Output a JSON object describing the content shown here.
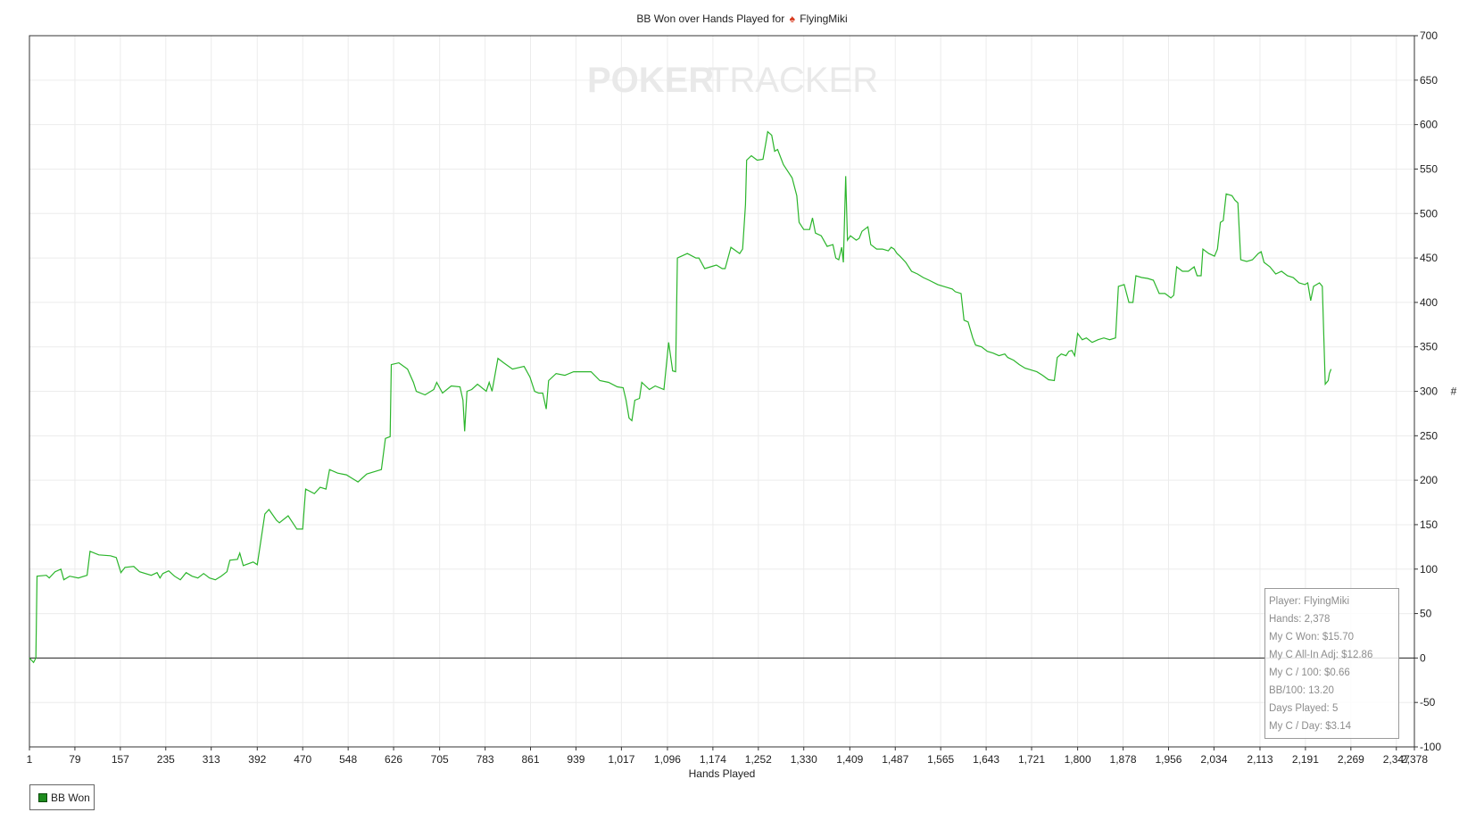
{
  "title_prefix": "BB Won over Hands Played for",
  "player_name": "FlyingMiki",
  "watermark": {
    "left": "POKER",
    "right": "TRACKER"
  },
  "legend": {
    "label": "BB Won",
    "swatch_color": "#1e8c1e",
    "icon": "green-square-icon"
  },
  "title_icon": "spade-icon",
  "stats": [
    "Player: FlyingMiki",
    "Hands: 2,378",
    "My C Won: $15.70",
    "My C All-In Adj: $12.86",
    "My C / 100: $0.66",
    "BB/100: 13.20",
    "Days Played: 5",
    "My C / Day: $3.14"
  ],
  "chart_data": {
    "type": "line",
    "title": "BB Won over Hands Played for FlyingMiki",
    "xlabel": "Hands Played",
    "ylabel": "#",
    "xlim": [
      1,
      2378
    ],
    "ylim": [
      -100,
      700
    ],
    "x_ticks": [
      "1",
      "79",
      "157",
      "235",
      "313",
      "392",
      "470",
      "548",
      "626",
      "705",
      "783",
      "861",
      "939",
      "1,017",
      "1,096",
      "1,174",
      "1,252",
      "1,330",
      "1,409",
      "1,487",
      "1,565",
      "1,643",
      "1,721",
      "1,800",
      "1,878",
      "1,956",
      "2,034",
      "2,113",
      "2,191",
      "2,269",
      "2,347",
      "2,378"
    ],
    "y_ticks": [
      700,
      650,
      600,
      550,
      500,
      450,
      400,
      350,
      300,
      250,
      200,
      150,
      100,
      50,
      0,
      -50,
      -100
    ],
    "grid": true,
    "legend_position": "bottom-left",
    "series": [
      {
        "name": "BB Won",
        "color": "#2bb52b",
        "points": [
          [
            1,
            0
          ],
          [
            8,
            -5
          ],
          [
            12,
            0
          ],
          [
            14,
            92
          ],
          [
            30,
            93
          ],
          [
            35,
            90
          ],
          [
            45,
            97
          ],
          [
            55,
            100
          ],
          [
            60,
            88
          ],
          [
            70,
            92
          ],
          [
            85,
            90
          ],
          [
            100,
            93
          ],
          [
            105,
            120
          ],
          [
            120,
            116
          ],
          [
            140,
            115
          ],
          [
            150,
            113
          ],
          [
            158,
            96
          ],
          [
            165,
            102
          ],
          [
            180,
            103
          ],
          [
            190,
            97
          ],
          [
            210,
            93
          ],
          [
            220,
            96
          ],
          [
            225,
            90
          ],
          [
            230,
            95
          ],
          [
            240,
            98
          ],
          [
            250,
            92
          ],
          [
            260,
            88
          ],
          [
            270,
            96
          ],
          [
            280,
            92
          ],
          [
            290,
            90
          ],
          [
            300,
            95
          ],
          [
            310,
            90
          ],
          [
            320,
            88
          ],
          [
            330,
            92
          ],
          [
            340,
            97
          ],
          [
            345,
            110
          ],
          [
            358,
            111
          ],
          [
            362,
            118
          ],
          [
            368,
            104
          ],
          [
            385,
            108
          ],
          [
            392,
            105
          ],
          [
            405,
            162
          ],
          [
            412,
            167
          ],
          [
            425,
            155
          ],
          [
            430,
            152
          ],
          [
            445,
            160
          ],
          [
            455,
            150
          ],
          [
            460,
            145
          ],
          [
            470,
            145
          ],
          [
            475,
            190
          ],
          [
            490,
            185
          ],
          [
            500,
            192
          ],
          [
            510,
            190
          ],
          [
            516,
            212
          ],
          [
            530,
            208
          ],
          [
            545,
            206
          ],
          [
            555,
            202
          ],
          [
            560,
            200
          ],
          [
            565,
            198
          ],
          [
            580,
            207
          ],
          [
            595,
            210
          ],
          [
            605,
            212
          ],
          [
            612,
            247
          ],
          [
            620,
            249
          ],
          [
            622,
            330
          ],
          [
            635,
            332
          ],
          [
            650,
            325
          ],
          [
            660,
            310
          ],
          [
            665,
            300
          ],
          [
            680,
            296
          ],
          [
            695,
            302
          ],
          [
            700,
            310
          ],
          [
            710,
            298
          ],
          [
            725,
            306
          ],
          [
            740,
            305
          ],
          [
            745,
            290
          ],
          [
            748,
            255
          ],
          [
            752,
            300
          ],
          [
            760,
            302
          ],
          [
            770,
            308
          ],
          [
            785,
            300
          ],
          [
            790,
            310
          ],
          [
            795,
            300
          ],
          [
            805,
            337
          ],
          [
            815,
            332
          ],
          [
            830,
            325
          ],
          [
            850,
            328
          ],
          [
            860,
            316
          ],
          [
            868,
            300
          ],
          [
            875,
            298
          ],
          [
            882,
            298
          ],
          [
            888,
            280
          ],
          [
            892,
            312
          ],
          [
            905,
            320
          ],
          [
            920,
            318
          ],
          [
            935,
            322
          ],
          [
            950,
            322
          ],
          [
            965,
            322
          ],
          [
            980,
            312
          ],
          [
            995,
            310
          ],
          [
            1010,
            305
          ],
          [
            1020,
            304
          ],
          [
            1025,
            290
          ],
          [
            1030,
            270
          ],
          [
            1035,
            267
          ],
          [
            1040,
            290
          ],
          [
            1048,
            292
          ],
          [
            1052,
            310
          ],
          [
            1065,
            302
          ],
          [
            1075,
            306
          ],
          [
            1090,
            302
          ],
          [
            1098,
            355
          ],
          [
            1105,
            323
          ],
          [
            1110,
            322
          ],
          [
            1113,
            450
          ],
          [
            1130,
            455
          ],
          [
            1145,
            450
          ],
          [
            1150,
            450
          ],
          [
            1160,
            438
          ],
          [
            1170,
            440
          ],
          [
            1180,
            442
          ],
          [
            1190,
            438
          ],
          [
            1195,
            438
          ],
          [
            1205,
            462
          ],
          [
            1220,
            455
          ],
          [
            1225,
            460
          ],
          [
            1230,
            510
          ],
          [
            1232,
            560
          ],
          [
            1240,
            565
          ],
          [
            1250,
            560
          ],
          [
            1260,
            561
          ],
          [
            1265,
            580
          ],
          [
            1268,
            592
          ],
          [
            1275,
            588
          ],
          [
            1280,
            570
          ],
          [
            1285,
            572
          ],
          [
            1295,
            555
          ],
          [
            1302,
            548
          ],
          [
            1310,
            540
          ],
          [
            1318,
            520
          ],
          [
            1322,
            490
          ],
          [
            1330,
            482
          ],
          [
            1340,
            482
          ],
          [
            1345,
            495
          ],
          [
            1350,
            478
          ],
          [
            1360,
            475
          ],
          [
            1370,
            463
          ],
          [
            1380,
            465
          ],
          [
            1385,
            450
          ],
          [
            1390,
            448
          ],
          [
            1395,
            462
          ],
          [
            1398,
            445
          ],
          [
            1402,
            542
          ],
          [
            1405,
            470
          ],
          [
            1410,
            475
          ],
          [
            1420,
            470
          ],
          [
            1425,
            472
          ],
          [
            1430,
            480
          ],
          [
            1440,
            485
          ],
          [
            1445,
            465
          ],
          [
            1455,
            460
          ],
          [
            1465,
            460
          ],
          [
            1475,
            458
          ],
          [
            1480,
            462
          ],
          [
            1485,
            460
          ],
          [
            1490,
            455
          ],
          [
            1495,
            452
          ],
          [
            1505,
            445
          ],
          [
            1515,
            435
          ],
          [
            1525,
            432
          ],
          [
            1535,
            428
          ],
          [
            1545,
            425
          ],
          [
            1560,
            420
          ],
          [
            1575,
            417
          ],
          [
            1585,
            415
          ],
          [
            1590,
            412
          ],
          [
            1600,
            410
          ],
          [
            1605,
            380
          ],
          [
            1612,
            378
          ],
          [
            1620,
            360
          ],
          [
            1625,
            352
          ],
          [
            1635,
            350
          ],
          [
            1645,
            345
          ],
          [
            1655,
            343
          ],
          [
            1665,
            340
          ],
          [
            1675,
            342
          ],
          [
            1680,
            338
          ],
          [
            1690,
            335
          ],
          [
            1700,
            330
          ],
          [
            1710,
            326
          ],
          [
            1720,
            324
          ],
          [
            1730,
            322
          ],
          [
            1740,
            318
          ],
          [
            1750,
            313
          ],
          [
            1760,
            312
          ],
          [
            1765,
            338
          ],
          [
            1772,
            342
          ],
          [
            1780,
            340
          ],
          [
            1785,
            345
          ],
          [
            1790,
            346
          ],
          [
            1795,
            340
          ],
          [
            1800,
            365
          ],
          [
            1808,
            358
          ],
          [
            1815,
            360
          ],
          [
            1825,
            355
          ],
          [
            1835,
            358
          ],
          [
            1845,
            360
          ],
          [
            1855,
            358
          ],
          [
            1865,
            360
          ],
          [
            1870,
            418
          ],
          [
            1880,
            420
          ],
          [
            1888,
            400
          ],
          [
            1895,
            400
          ],
          [
            1900,
            430
          ],
          [
            1910,
            428
          ],
          [
            1920,
            427
          ],
          [
            1930,
            425
          ],
          [
            1940,
            410
          ],
          [
            1950,
            410
          ],
          [
            1960,
            405
          ],
          [
            1965,
            408
          ],
          [
            1970,
            440
          ],
          [
            1980,
            435
          ],
          [
            1990,
            435
          ],
          [
            2000,
            440
          ],
          [
            2005,
            430
          ],
          [
            2012,
            430
          ],
          [
            2015,
            460
          ],
          [
            2025,
            455
          ],
          [
            2035,
            452
          ],
          [
            2040,
            460
          ],
          [
            2045,
            490
          ],
          [
            2050,
            492
          ],
          [
            2055,
            522
          ],
          [
            2065,
            520
          ],
          [
            2070,
            515
          ],
          [
            2075,
            512
          ],
          [
            2080,
            448
          ],
          [
            2090,
            446
          ],
          [
            2100,
            448
          ],
          [
            2110,
            455
          ],
          [
            2115,
            457
          ],
          [
            2120,
            445
          ],
          [
            2130,
            440
          ],
          [
            2140,
            432
          ],
          [
            2150,
            435
          ],
          [
            2160,
            430
          ],
          [
            2170,
            428
          ],
          [
            2180,
            422
          ],
          [
            2190,
            420
          ],
          [
            2195,
            422
          ],
          [
            2200,
            402
          ],
          [
            2205,
            418
          ],
          [
            2215,
            422
          ],
          [
            2220,
            418
          ],
          [
            2225,
            308
          ],
          [
            2230,
            312
          ],
          [
            2232,
            320
          ],
          [
            2235,
            325
          ]
        ]
      }
    ]
  }
}
